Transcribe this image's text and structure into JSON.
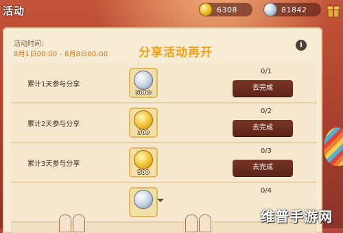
{
  "header": {
    "title": "活动",
    "coins": "6308",
    "gems": "81842",
    "coin_icon": "gold-coin-icon",
    "gem_icon": "diamond-icon",
    "gift_icon": "gift-icon"
  },
  "event": {
    "time_label": "活动时间:",
    "time_range": "8月1日00:00 - 8月8日00:00",
    "title": "分享活动再开",
    "info_icon": "i"
  },
  "tasks": [
    {
      "desc": "累计1天参与分享",
      "reward_type": "silver",
      "reward_amount": "5000",
      "progress": "0/1",
      "button": "去完成"
    },
    {
      "desc": "累计2天参与分享",
      "reward_type": "gold",
      "reward_amount": "300",
      "progress": "0/2",
      "button": "去完成"
    },
    {
      "desc": "累计3天参与分享",
      "reward_type": "gold",
      "reward_amount": "500",
      "progress": "0/3",
      "button": "去完成"
    },
    {
      "desc": "",
      "reward_type": "silver",
      "reward_amount": "",
      "progress": "0/4",
      "button": ""
    }
  ],
  "watermark": "维普手游网",
  "colors": {
    "accent_orange": "#f2a012",
    "time_orange": "#e06d12",
    "button_brown": "#6a2c1f",
    "panel_cream": "#f7ecd6"
  }
}
